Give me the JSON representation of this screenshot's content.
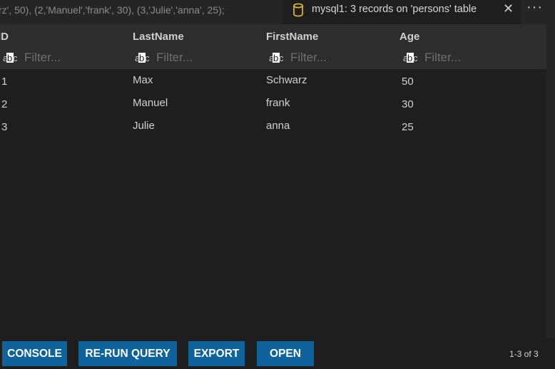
{
  "editor": {
    "inactive_tab_text": "rz', 50), (2,'Manuel','frank', 30), (3,'Julie','anna',  25);",
    "active_tab_title": "mysql1: 3 records on 'persons' table",
    "icons": {
      "db": "database-icon",
      "close": "close-icon",
      "more": "more-actions-icon"
    },
    "close_glyph": "✕",
    "more_glyph": "···"
  },
  "grid": {
    "columns": [
      {
        "name": "ID",
        "filter_placeholder": "Filter..."
      },
      {
        "name": "LastName",
        "filter_placeholder": "Filter..."
      },
      {
        "name": "FirstName",
        "filter_placeholder": "Filter..."
      },
      {
        "name": "Age",
        "filter_placeholder": "Filter..."
      }
    ],
    "rows": [
      [
        "1",
        "Max",
        "Schwarz",
        "50"
      ],
      [
        "2",
        "Manuel",
        "frank",
        "30"
      ],
      [
        "3",
        "Julie",
        "anna",
        "25"
      ]
    ]
  },
  "footer": {
    "buttons": [
      "CONSOLE",
      "RE-RUN QUERY",
      "EXPORT",
      "OPEN"
    ],
    "pager": "1-3 of 3"
  },
  "colors": {
    "background": "#1e1e1e",
    "header_background": "#2d2d2d",
    "button": "#0e639c",
    "icon_yellow": "#e8c11f"
  }
}
